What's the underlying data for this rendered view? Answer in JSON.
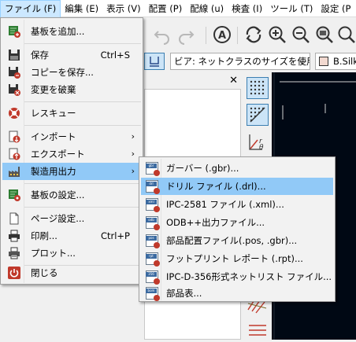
{
  "menubar": {
    "items": [
      {
        "label": "ファイル (F)",
        "active": true
      },
      {
        "label": "編集 (E)"
      },
      {
        "label": "表示 (V)"
      },
      {
        "label": "配置 (P)"
      },
      {
        "label": "配線 (u)"
      },
      {
        "label": "検査 (I)"
      },
      {
        "label": "ツール (T)"
      },
      {
        "label": "設定 (P"
      }
    ]
  },
  "toolbar": {
    "net_class_combo": "ビア: ネットクラスのサイズを使用",
    "layer_combo": "B.Silk"
  },
  "file_menu": {
    "items": [
      {
        "label": "基板を追加...",
        "icon": "add-board-icon"
      },
      {
        "separator": true
      },
      {
        "label": "保存",
        "shortcut": "Ctrl+S",
        "icon": "save-icon"
      },
      {
        "label": "コピーを保存...",
        "icon": "save-copy-icon"
      },
      {
        "label": "変更を破棄",
        "icon": "revert-icon"
      },
      {
        "separator": true
      },
      {
        "label": "レスキュー",
        "icon": "rescue-icon"
      },
      {
        "separator": true
      },
      {
        "label": "インポート",
        "submenu": true,
        "icon": "import-icon"
      },
      {
        "label": "エクスポート",
        "submenu": true,
        "icon": "export-icon"
      },
      {
        "label": "製造用出力",
        "submenu": true,
        "icon": "fabrication-icon",
        "highlighted": true
      },
      {
        "separator": true
      },
      {
        "label": "基板の設定...",
        "icon": "board-setup-icon"
      },
      {
        "separator": true
      },
      {
        "label": "ページ設定...",
        "icon": "page-setup-icon"
      },
      {
        "label": "印刷...",
        "shortcut": "Ctrl+P",
        "icon": "print-icon"
      },
      {
        "label": "プロット...",
        "icon": "plot-icon"
      },
      {
        "separator": true
      },
      {
        "label": "閉じる",
        "icon": "power-icon"
      }
    ]
  },
  "fab_submenu": {
    "items": [
      {
        "label": "ガーバー (.gbr)...",
        "tag": "gbr",
        "highlighted": false
      },
      {
        "label": "ドリル ファイル (.drl)...",
        "tag": "drl",
        "highlighted": true
      },
      {
        "label": "IPC-2581 ファイル (.xml)...",
        "tag": "xml",
        "highlighted": false
      },
      {
        "label": "ODB++出力ファイル...",
        "tag": "odb",
        "highlighted": false
      },
      {
        "label": "部品配置ファイル(.pos, .gbr)...",
        "tag": "pos",
        "highlighted": false
      },
      {
        "label": "フットプリント レポート (.rpt)...",
        "tag": "rpt",
        "highlighted": false
      },
      {
        "label": "IPC-D-356形式ネットリスト ファイル...",
        "tag": "356",
        "highlighted": false
      },
      {
        "label": "部品表...",
        "tag": "bom",
        "highlighted": false
      }
    ]
  },
  "colors": {
    "highlight": "#91c9f7",
    "menubar_active": "#cce8ff",
    "canvas_bg": "#000814",
    "badge": "#c0392b"
  }
}
